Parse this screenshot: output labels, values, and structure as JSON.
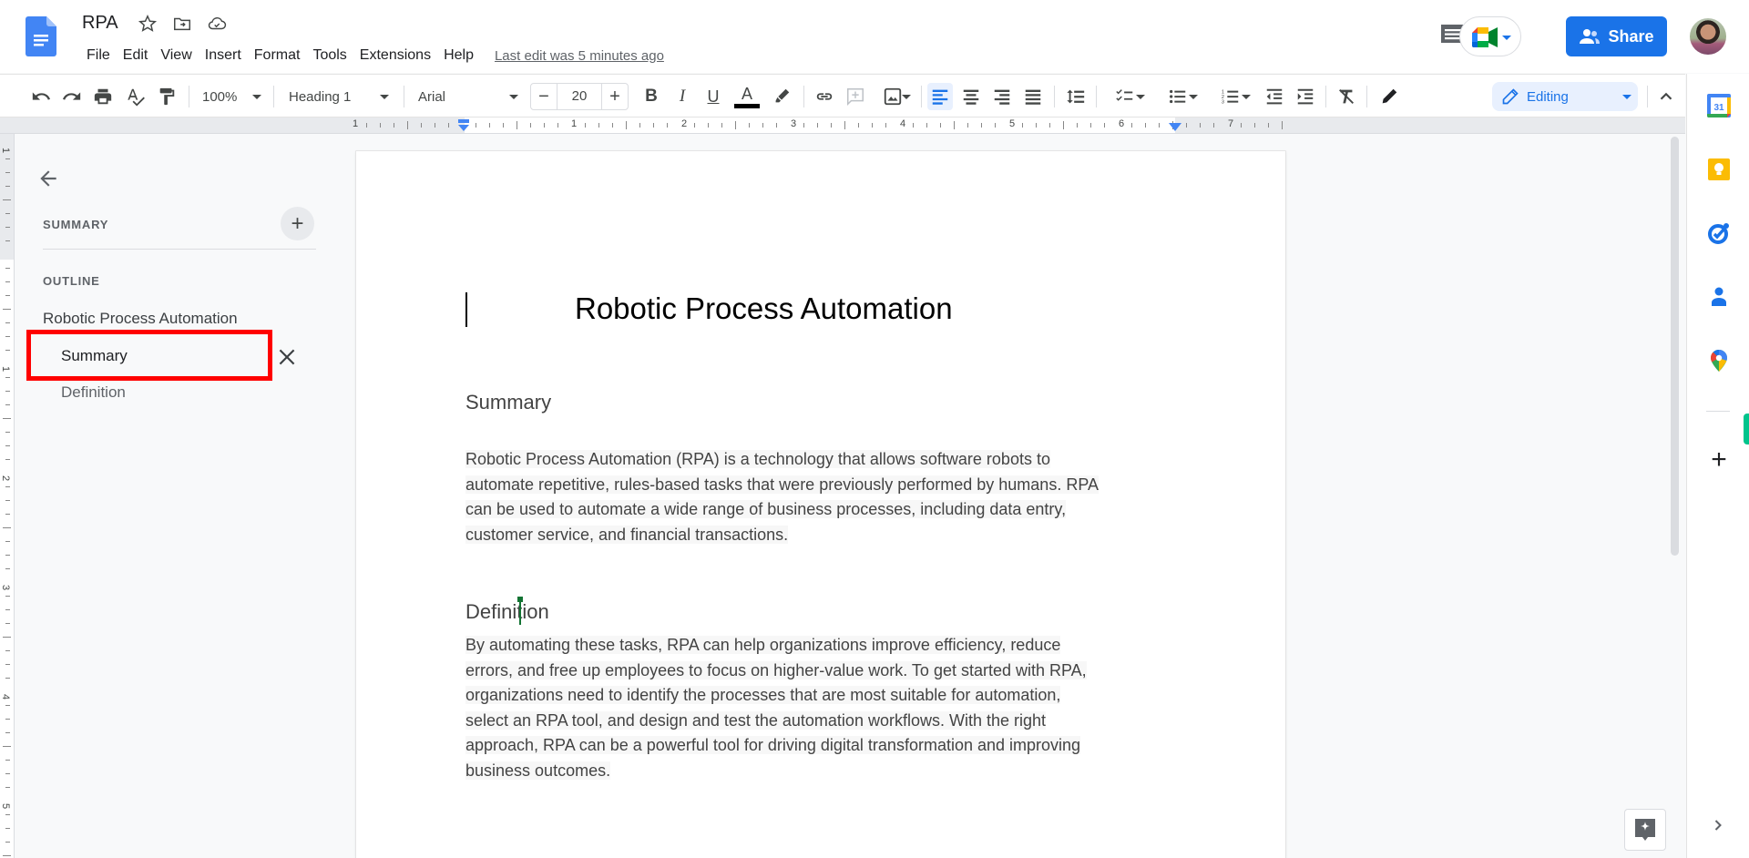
{
  "app": {
    "doc_title": "RPA",
    "menus": [
      "File",
      "Edit",
      "View",
      "Insert",
      "Format",
      "Tools",
      "Extensions",
      "Help"
    ],
    "last_edit": "Last edit was 5 minutes ago",
    "share_label": "Share"
  },
  "toolbar": {
    "zoom": "100%",
    "style": "Heading 1",
    "font": "Arial",
    "font_size": "20",
    "decrease_label": "−",
    "increase_label": "+",
    "mode": "Editing",
    "text_color": "#000000"
  },
  "ruler": {
    "horizontal_labels": [
      "1",
      "1",
      "2",
      "3",
      "4",
      "5",
      "6",
      "7"
    ],
    "vertical_labels": [
      "1",
      "1",
      "2",
      "3",
      "4",
      "5"
    ]
  },
  "outline": {
    "summary_label": "SUMMARY",
    "add_summary_label": "+",
    "outline_label": "OUTLINE",
    "items": [
      {
        "label": "Robotic Process Automation",
        "level": 1
      },
      {
        "label": "Summary",
        "level": 2,
        "selected": true
      },
      {
        "label": "Definition",
        "level": 2
      }
    ]
  },
  "document": {
    "title": "Robotic Process Automation",
    "sections": [
      {
        "heading": "Summary",
        "paragraph_lines": [
          "Robotic Process Automation (RPA) is a technology that allows software robots to",
          "automate repetitive, rules-based tasks that were previously performed by humans. RPA",
          "can be used to automate a wide range of business processes, including data entry,",
          "customer service, and financial transactions."
        ]
      },
      {
        "heading": "Definition",
        "paragraph_lines": [
          "By automating these tasks, RPA can help organizations improve efficiency, reduce",
          "errors, and free up employees to focus on higher-value work. To get started with RPA,",
          "organizations need to identify the processes that are most suitable for automation,",
          "select an RPA tool, and design and test the automation workflows. With the right",
          "approach, RPA can be a powerful tool for driving digital transformation and improving",
          "business outcomes."
        ]
      }
    ]
  },
  "side_panel": {
    "apps": [
      "calendar",
      "keep",
      "tasks",
      "contacts",
      "maps"
    ],
    "calendar_day": "31",
    "add_label": "+"
  },
  "colors": {
    "accent": "#1a73e8",
    "highlight_box": "#ff0000",
    "collab_cursor": "#137333"
  }
}
